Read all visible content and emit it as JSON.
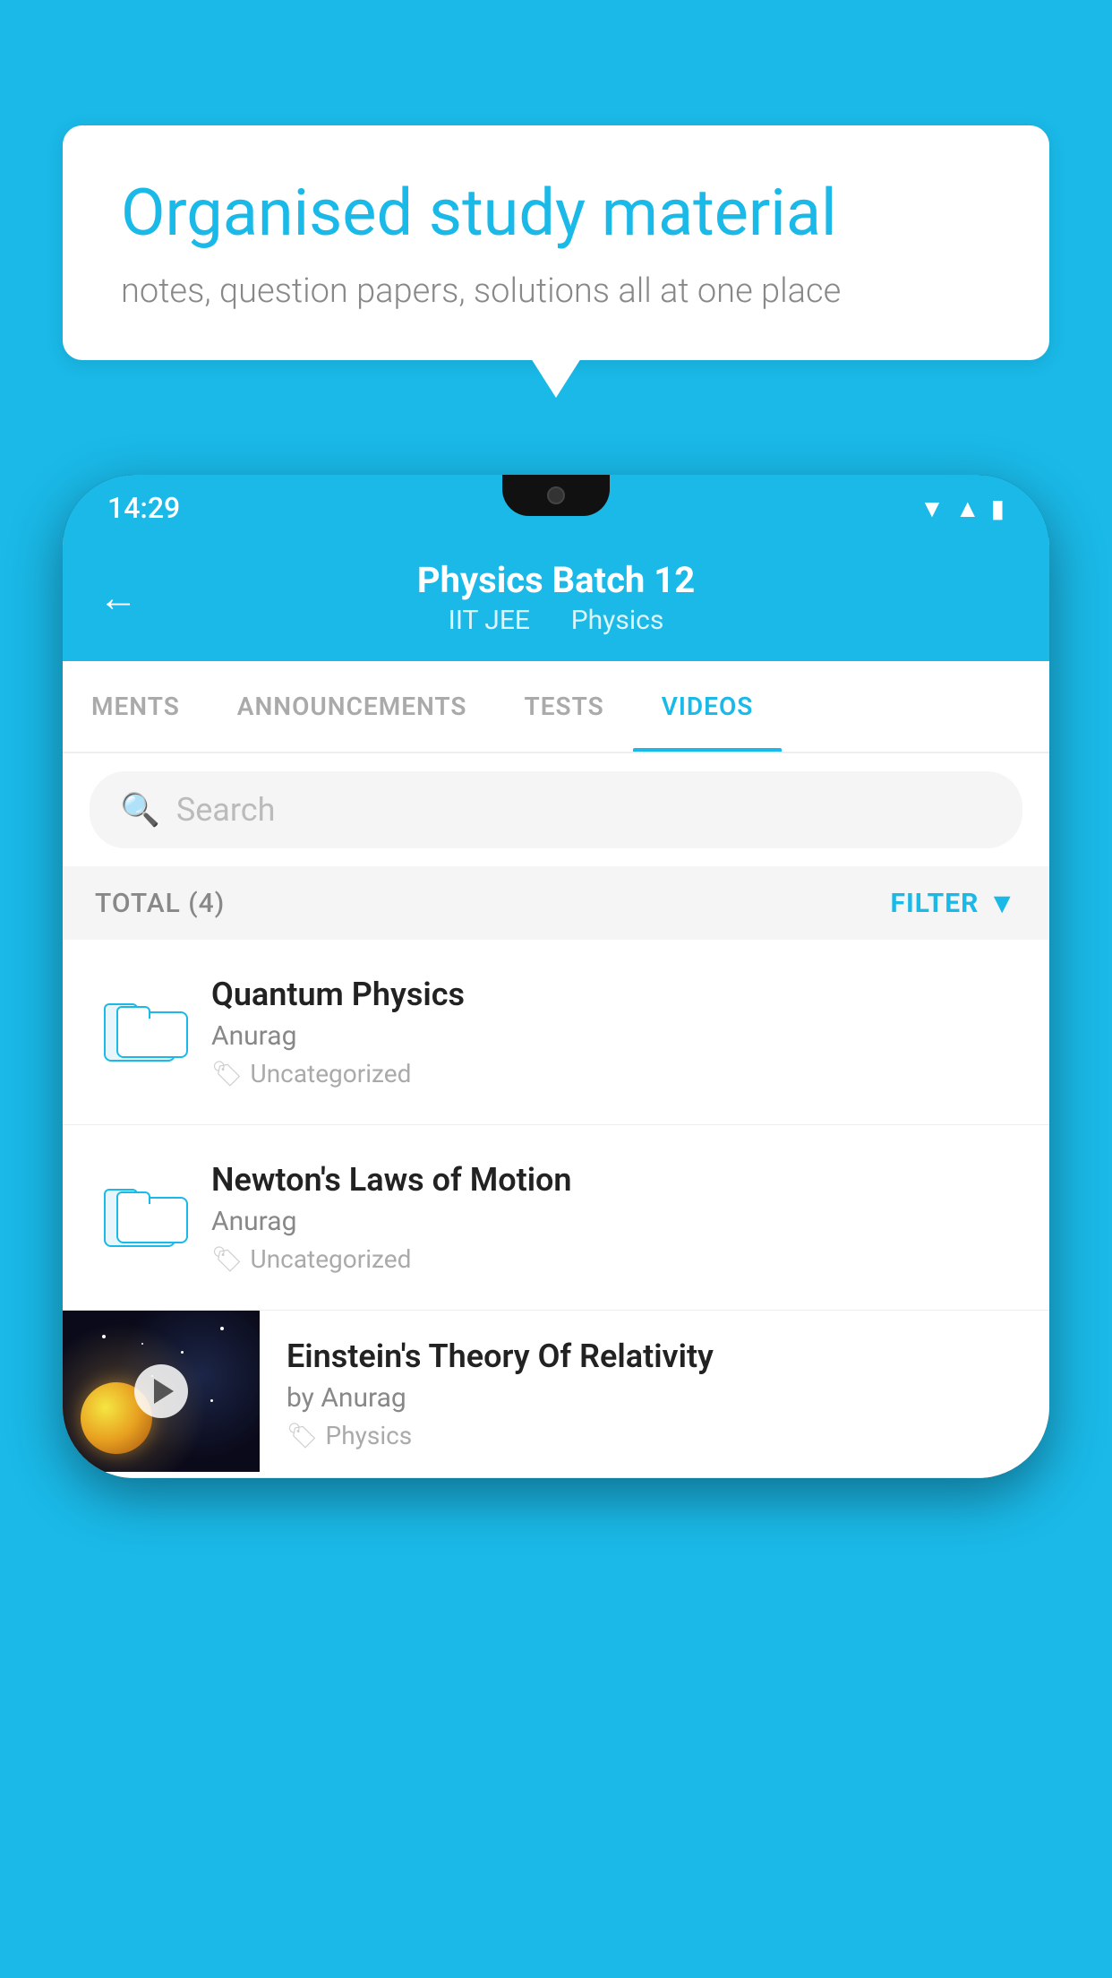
{
  "background_color": "#1ab9e8",
  "speech_bubble": {
    "heading": "Organised study material",
    "subtext": "notes, question papers, solutions all at one place"
  },
  "phone": {
    "status_bar": {
      "time": "14:29",
      "icons": [
        "wifi",
        "signal",
        "battery"
      ]
    },
    "header": {
      "back_label": "←",
      "title": "Physics Batch 12",
      "subtitle_part1": "IIT JEE",
      "subtitle_part2": "Physics"
    },
    "tabs": [
      {
        "label": "MENTS",
        "active": false
      },
      {
        "label": "ANNOUNCEMENTS",
        "active": false
      },
      {
        "label": "TESTS",
        "active": false
      },
      {
        "label": "VIDEOS",
        "active": true
      }
    ],
    "search": {
      "placeholder": "Search"
    },
    "filter_row": {
      "total_label": "TOTAL (4)",
      "filter_label": "FILTER"
    },
    "videos": [
      {
        "title": "Quantum Physics",
        "author": "Anurag",
        "tag": "Uncategorized",
        "type": "folder"
      },
      {
        "title": "Newton's Laws of Motion",
        "author": "Anurag",
        "tag": "Uncategorized",
        "type": "folder"
      },
      {
        "title": "Einstein's Theory Of Relativity",
        "author": "by Anurag",
        "tag": "Physics",
        "type": "video"
      }
    ]
  }
}
